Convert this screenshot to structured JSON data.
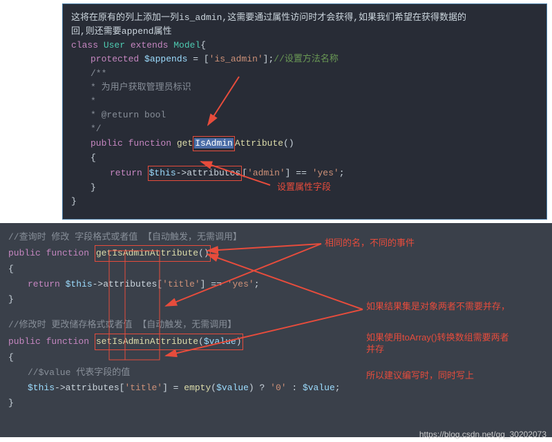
{
  "block1": {
    "comment_line1": "这将在原有的列上添加一列is_admin,这需要通过属性访问时才会获得,如果我们希望在获得数据的",
    "comment_line2": "回,则还需要append属性",
    "line1_pre": "class ",
    "line1_cls": "User",
    "line1_mid": " extends ",
    "line1_cls2": "Model",
    "line1_post": "{",
    "line2_pre": "protected ",
    "line2_var": "$appends",
    "line2_mid": " = [",
    "line2_str": "'is_admin'",
    "line2_post": "];",
    "line2_cmt": "//设置方法名称",
    "doc1": "/**",
    "doc2": "* 为用户获取管理员标识",
    "doc3": "*",
    "doc4": "* @return bool",
    "doc5": "*/",
    "fn_pre": "public function ",
    "fn_name_pre": "get",
    "fn_name_hl": "IsAdmin",
    "fn_name_post": "Attribute",
    "fn_paren": "()",
    "brace_open": "{",
    "ret_pre": "return ",
    "ret_var": "$this",
    "ret_arrow": "->",
    "ret_attr": "attributes",
    "ret_mid": "[",
    "ret_str1": "'admin'",
    "ret_mid2": "] == ",
    "ret_str2": "'yes'",
    "ret_end": ";",
    "brace_close": "}",
    "outer_brace": "}",
    "annotation1": "设置属性字段"
  },
  "block2": {
    "cmt1": "//查询时 修改 字段格式或者值 【自动触发，无需调用】",
    "fn1_pre": "public function ",
    "fn1_name": "getIsAdminAttribute",
    "fn1_paren": "()",
    "brace1": "{",
    "ret_pre": "return ",
    "ret_var": "$this",
    "ret_arrow": "->",
    "ret_attr": "attributes",
    "ret_mid": "[",
    "ret_str1": "'title'",
    "ret_mid2": "] == ",
    "ret_str2": "'yes'",
    "ret_end": ";",
    "brace1c": "}",
    "cmt2": "//修改时 更改储存格式或者值 【自动触发，无需调用】",
    "fn2_pre": "public function ",
    "fn2_name": "setIsAdminAttribute",
    "fn2_paren_open": "(",
    "fn2_param": "$value",
    "fn2_paren_close": ")",
    "brace2": "{",
    "cmt3": "//$value 代表字段的值",
    "set_var": "$this",
    "set_arrow": "->",
    "set_attr": "attributes",
    "set_mid": "[",
    "set_str1": "'title'",
    "set_mid2": "] = ",
    "set_fn": "empty",
    "set_p1": "(",
    "set_param": "$value",
    "set_p2": ") ? ",
    "set_zero": "'0'",
    "set_colon": " : ",
    "set_val2": "$value",
    "set_end": ";",
    "brace2c": "}",
    "ann1": "相同的名，不同的事件",
    "ann2": "如果结果集是对象两者不需要并存，",
    "ann3a": "如果使用",
    "ann3b": "toArray()",
    "ann3c": "转换数组需要两者",
    "ann3d": "并存",
    "ann4": "所以建议编写时，同时写上"
  },
  "watermark": "https://blog.csdn.net/qq_30202073"
}
